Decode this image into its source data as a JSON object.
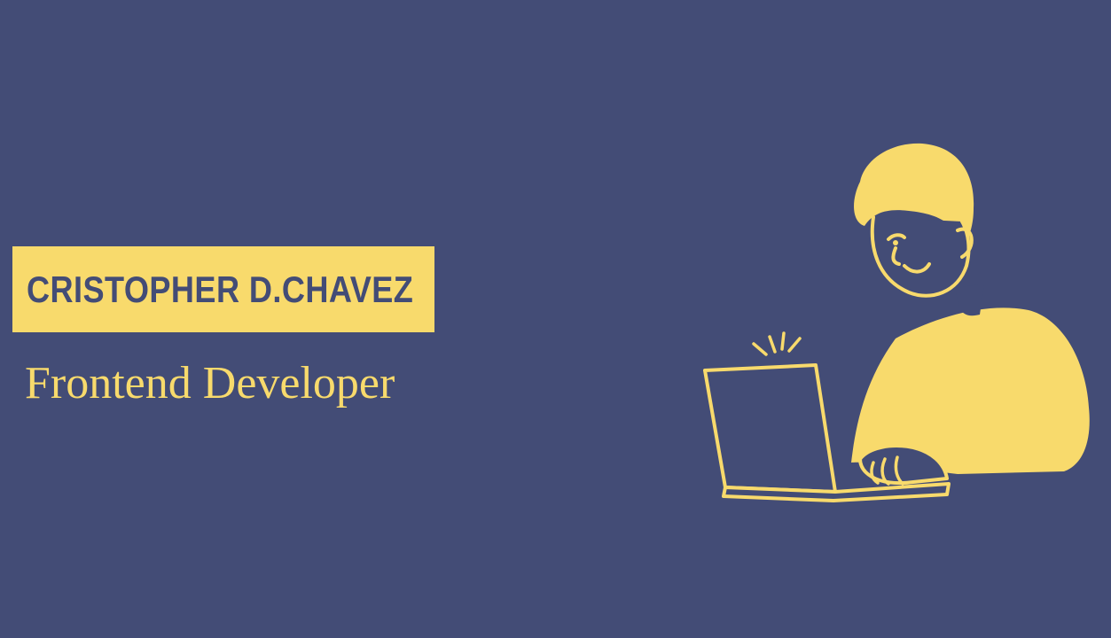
{
  "hero": {
    "name": "CRISTOPHER D.CHAVEZ",
    "role": "Frontend Developer"
  },
  "colors": {
    "background": "#434c76",
    "accent": "#f8da6c",
    "name_text": "#434c76"
  },
  "illustration": {
    "icon": "person-with-laptop-illustration"
  }
}
